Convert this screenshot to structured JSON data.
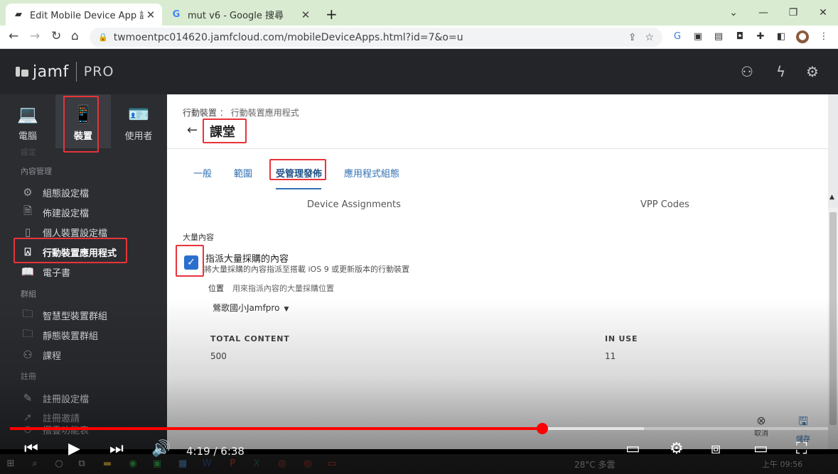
{
  "browser": {
    "tabs": [
      {
        "title": "Edit Mobile Device App 課堂**",
        "favicon": "jamf-icon"
      },
      {
        "title": "mut v6 - Google 搜尋",
        "favicon": "G"
      }
    ],
    "new_tab": "+",
    "url": "twmoentpc014620.jamfcloud.com/mobileDeviceApps.html?id=7&o=u"
  },
  "jamf": {
    "brand": "jamf",
    "product": "PRO"
  },
  "sidebar": {
    "top_categories": [
      {
        "label": "電腦",
        "icon": "laptop-icon"
      },
      {
        "label": "裝置",
        "icon": "mobile-device-icon"
      },
      {
        "label": "使用者",
        "icon": "user-card-icon"
      }
    ],
    "clipped_top": "設定",
    "sections": {
      "content": "內容管理",
      "groups": "群組",
      "enrollment": "註冊"
    },
    "items": [
      {
        "label": "組態設定檔",
        "icon": "gear-icon"
      },
      {
        "label": "佈建設定檔",
        "icon": "document-icon"
      },
      {
        "label": "個人裝置設定檔",
        "icon": "device-profile-icon"
      },
      {
        "label": "行動裝置應用程式",
        "icon": "app-store-icon"
      },
      {
        "label": "電子書",
        "icon": "book-icon"
      },
      {
        "label": "智慧型裝置群組",
        "icon": "smart-group-icon"
      },
      {
        "label": "靜態裝置群組",
        "icon": "static-group-icon"
      },
      {
        "label": "課程",
        "icon": "classes-icon"
      },
      {
        "label": "註冊設定檔",
        "icon": "enrollment-profile-icon"
      },
      {
        "label": "註冊邀請",
        "icon": "invitation-icon"
      },
      {
        "label": "摺疊功能表",
        "icon": "collapse-icon"
      }
    ]
  },
  "page": {
    "breadcrumb_parent": "行動裝置",
    "breadcrumb_sep": "：",
    "breadcrumb_current": "行動裝置應用程式",
    "back": "←",
    "title": "課堂",
    "tabs": [
      "一般",
      "範圍",
      "受管理發佈",
      "應用程式組態"
    ],
    "subtabs": [
      "Device Assignments",
      "VPP Codes"
    ],
    "volume_label": "大量內容",
    "assign_checkbox_label": "指派大量採購的內容",
    "assign_checkbox_desc": "將大量採購的內容指派至搭載 iOS 9 或更新版本的行動裝置",
    "assign_checked": true,
    "location_label": "位置",
    "location_desc": "用來指派內容的大量採購位置",
    "location_value": "鶯歌國小Jamfpro",
    "total_content_header": "TOTAL CONTENT",
    "total_content_value": "500",
    "in_use_header": "IN USE",
    "in_use_value": "11",
    "cancel_label": "取消",
    "save_label": "儲存"
  },
  "video": {
    "time": "4:19 / 6:38",
    "played_fraction": 0.651,
    "buffered_fraction": 0.775
  },
  "taskbar": {
    "weather": "28°C  多雲",
    "clock": "上午 09:56"
  },
  "colors": {
    "highlight": "#e8333a",
    "progress": "#ff0000",
    "accent": "#2f6fb3",
    "sidebar_bg": "#2b2d31"
  }
}
